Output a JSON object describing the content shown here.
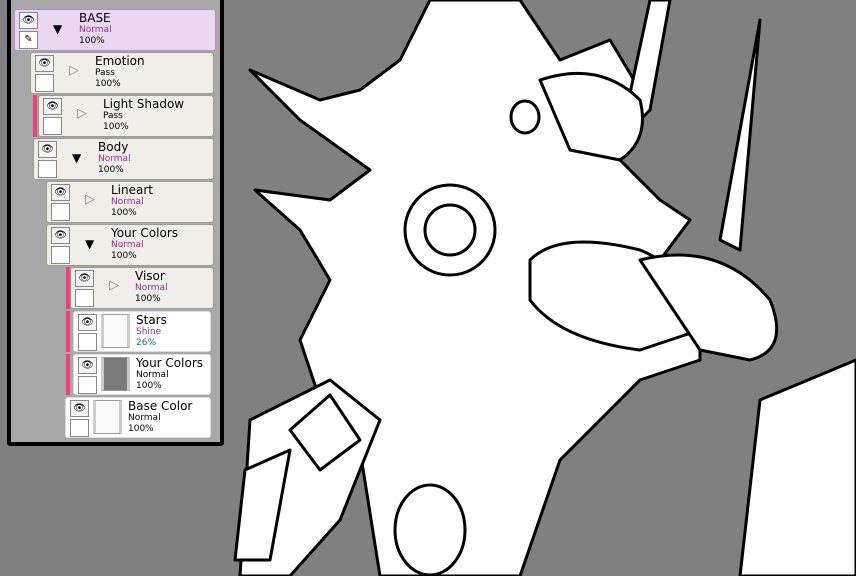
{
  "colors": {
    "canvas": "#808080",
    "selected": "#ead8f2",
    "clip_marker": "#f0407a",
    "mode_purple": "#9a2aa0",
    "mode_dark": "#000000",
    "opacity_teal": "#108070"
  },
  "icons": {
    "visibility": "eye-icon",
    "edit": "pencil-icon",
    "expanded": "triangle-down-icon",
    "collapsed": "triangle-right-icon"
  },
  "layers": [
    {
      "name": "BASE",
      "mode": "Normal",
      "opacity": "100%",
      "type": "folder",
      "expanded": true,
      "selected": true
    },
    {
      "name": "Emotion",
      "mode": "Pass",
      "opacity": "100%",
      "type": "folder",
      "expanded": false
    },
    {
      "name": "Light Shadow",
      "mode": "Pass",
      "opacity": "100%",
      "type": "folder",
      "expanded": false,
      "clipped": true
    },
    {
      "name": "Body",
      "mode": "Normal",
      "opacity": "100%",
      "type": "folder",
      "expanded": true
    },
    {
      "name": "Lineart",
      "mode": "Normal",
      "opacity": "100%",
      "type": "folder",
      "expanded": false
    },
    {
      "name": "Your Colors",
      "mode": "Normal",
      "opacity": "100%",
      "type": "folder",
      "expanded": true
    },
    {
      "name": "Visor",
      "mode": "Normal",
      "opacity": "100%",
      "type": "folder",
      "expanded": false,
      "clipped": true
    },
    {
      "name": "Stars",
      "mode": "Shine",
      "opacity": "26%",
      "type": "raster",
      "clipped": true,
      "thumb": "#fafafa"
    },
    {
      "name": "Your Colors",
      "mode": "Normal",
      "opacity": "100%",
      "type": "raster",
      "clipped": true,
      "thumb": "#7a7a7a"
    },
    {
      "name": "Base Color",
      "mode": "Normal",
      "opacity": "100%",
      "type": "raster",
      "thumb": "#fafafa"
    }
  ]
}
